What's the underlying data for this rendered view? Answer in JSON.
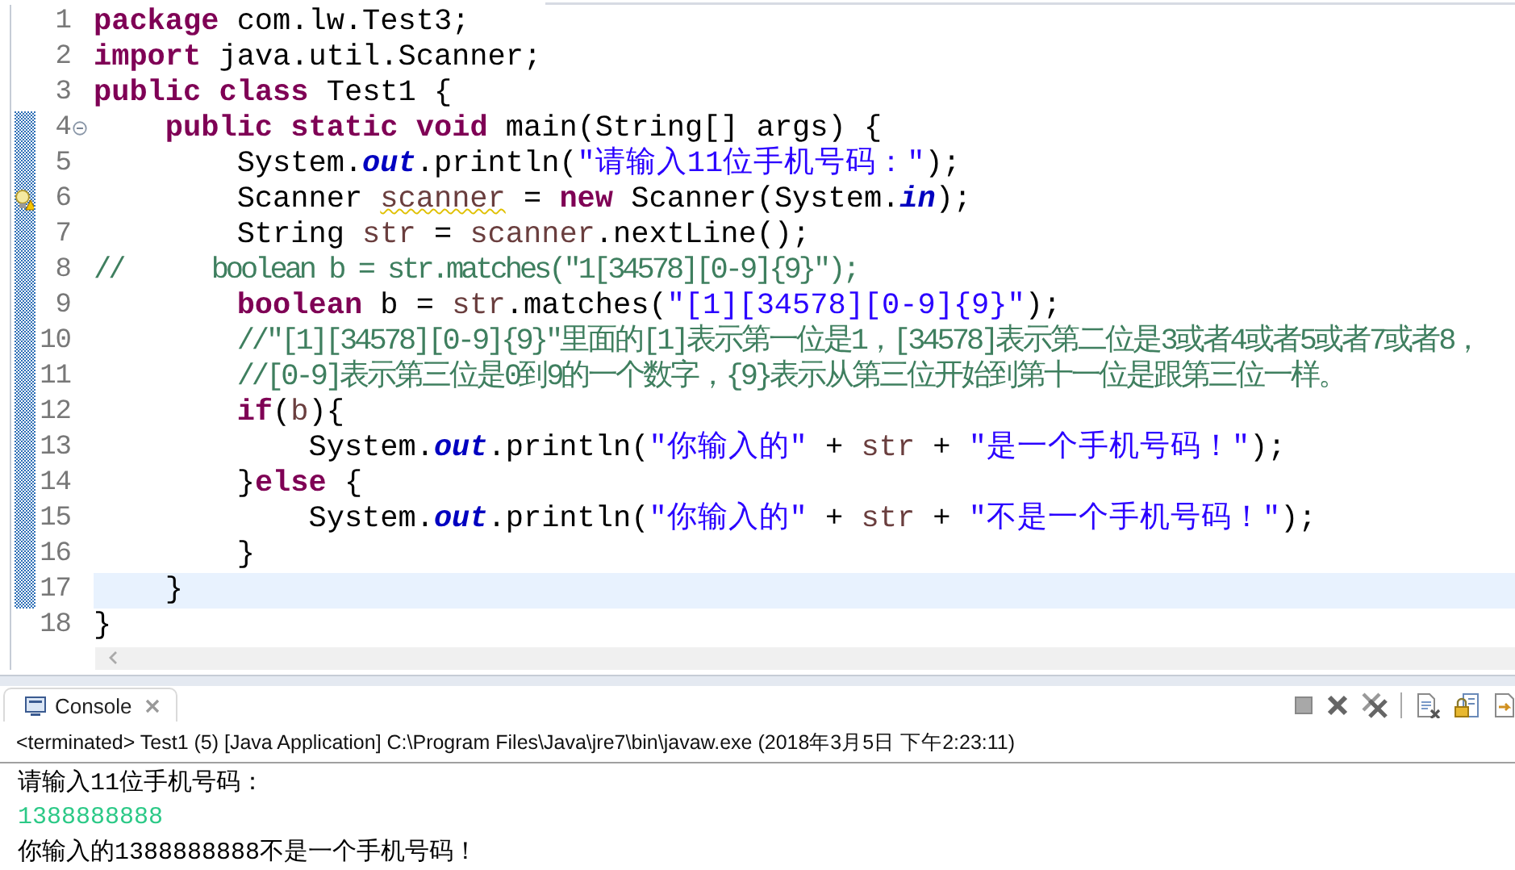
{
  "editor": {
    "lines": [
      {
        "number": "1",
        "changed": false,
        "current": false,
        "collapsible": false,
        "has_warning": false,
        "tokens": [
          {
            "kind": "keyword",
            "text": "package"
          },
          {
            "kind": "plain",
            "text": " com.lw.Test3;"
          }
        ]
      },
      {
        "number": "2",
        "changed": false,
        "current": false,
        "collapsible": false,
        "has_warning": false,
        "tokens": [
          {
            "kind": "keyword",
            "text": "import"
          },
          {
            "kind": "plain",
            "text": " java.util.Scanner;"
          }
        ]
      },
      {
        "number": "3",
        "changed": false,
        "current": false,
        "collapsible": false,
        "has_warning": false,
        "tokens": [
          {
            "kind": "keyword",
            "text": "public"
          },
          {
            "kind": "keyword",
            "text": " class"
          },
          {
            "kind": "plain",
            "text": " Test1 {"
          }
        ]
      },
      {
        "number": "4",
        "changed": true,
        "current": false,
        "collapsible": true,
        "has_warning": false,
        "tokens": [
          {
            "kind": "keyword",
            "text": "    public"
          },
          {
            "kind": "keyword",
            "text": " static"
          },
          {
            "kind": "keyword",
            "text": " void"
          },
          {
            "kind": "plain",
            "text": " main(String[] args) {"
          }
        ]
      },
      {
        "number": "5",
        "changed": true,
        "current": false,
        "collapsible": false,
        "has_warning": false,
        "tokens": [
          {
            "kind": "plain",
            "text": "        System."
          },
          {
            "kind": "field",
            "text": "out"
          },
          {
            "kind": "plain",
            "text": ".println("
          },
          {
            "kind": "string",
            "text": "\"请输入11位手机号码：\""
          },
          {
            "kind": "plain",
            "text": ");"
          }
        ]
      },
      {
        "number": "6",
        "changed": true,
        "current": false,
        "collapsible": false,
        "has_warning": true,
        "tokens": [
          {
            "kind": "plain",
            "text": "        Scanner "
          },
          {
            "kind": "local_warning",
            "text": "scanner"
          },
          {
            "kind": "plain",
            "text": " = "
          },
          {
            "kind": "keyword",
            "text": "new"
          },
          {
            "kind": "plain",
            "text": " Scanner(System."
          },
          {
            "kind": "field",
            "text": "in"
          },
          {
            "kind": "plain",
            "text": ");"
          }
        ]
      },
      {
        "number": "7",
        "changed": true,
        "current": false,
        "collapsible": false,
        "has_warning": false,
        "tokens": [
          {
            "kind": "plain",
            "text": "        String "
          },
          {
            "kind": "local",
            "text": "str"
          },
          {
            "kind": "plain",
            "text": " = "
          },
          {
            "kind": "local",
            "text": "scanner"
          },
          {
            "kind": "plain",
            "text": ".nextLine();"
          }
        ]
      },
      {
        "number": "8",
        "changed": true,
        "current": false,
        "collapsible": false,
        "has_warning": false,
        "tokens": [
          {
            "kind": "comment",
            "text": "//      boolean b = str.matches(\"1[34578][0-9]{9}\");"
          }
        ]
      },
      {
        "number": "9",
        "changed": true,
        "current": false,
        "collapsible": false,
        "has_warning": false,
        "tokens": [
          {
            "kind": "keyword",
            "text": "        boolean"
          },
          {
            "kind": "plain",
            "text": " b = "
          },
          {
            "kind": "local",
            "text": "str"
          },
          {
            "kind": "plain",
            "text": ".matches("
          },
          {
            "kind": "string",
            "text": "\"[1][34578][0-9]{9}\""
          },
          {
            "kind": "plain",
            "text": ");"
          }
        ]
      },
      {
        "number": "10",
        "changed": true,
        "current": false,
        "collapsible": false,
        "has_warning": false,
        "tokens": [
          {
            "kind": "comment",
            "text": "        //\"[1][34578][0-9]{9}\"里面的[1]表示第一位是1，[34578]表示第二位是3或者4或者5或者7或者8，"
          }
        ]
      },
      {
        "number": "11",
        "changed": true,
        "current": false,
        "collapsible": false,
        "has_warning": false,
        "tokens": [
          {
            "kind": "comment",
            "text": "        //[0-9]表示第三位是0到9的一个数字，{9}表示从第三位开始到第十一位是跟第三位一样。"
          }
        ]
      },
      {
        "number": "12",
        "changed": true,
        "current": false,
        "collapsible": false,
        "has_warning": false,
        "tokens": [
          {
            "kind": "keyword",
            "text": "        if"
          },
          {
            "kind": "plain",
            "text": "("
          },
          {
            "kind": "local",
            "text": "b"
          },
          {
            "kind": "plain",
            "text": "){"
          }
        ]
      },
      {
        "number": "13",
        "changed": true,
        "current": false,
        "collapsible": false,
        "has_warning": false,
        "tokens": [
          {
            "kind": "plain",
            "text": "            System."
          },
          {
            "kind": "field",
            "text": "out"
          },
          {
            "kind": "plain",
            "text": ".println("
          },
          {
            "kind": "string",
            "text": "\"你输入的\""
          },
          {
            "kind": "plain",
            "text": " + "
          },
          {
            "kind": "local",
            "text": "str"
          },
          {
            "kind": "plain",
            "text": " + "
          },
          {
            "kind": "string",
            "text": "\"是一个手机号码！\""
          },
          {
            "kind": "plain",
            "text": ");"
          }
        ]
      },
      {
        "number": "14",
        "changed": true,
        "current": false,
        "collapsible": false,
        "has_warning": false,
        "tokens": [
          {
            "kind": "plain",
            "text": "        }"
          },
          {
            "kind": "keyword",
            "text": "else"
          },
          {
            "kind": "plain",
            "text": " {"
          }
        ]
      },
      {
        "number": "15",
        "changed": true,
        "current": false,
        "collapsible": false,
        "has_warning": false,
        "tokens": [
          {
            "kind": "plain",
            "text": "            System."
          },
          {
            "kind": "field",
            "text": "out"
          },
          {
            "kind": "plain",
            "text": ".println("
          },
          {
            "kind": "string",
            "text": "\"你输入的\""
          },
          {
            "kind": "plain",
            "text": " + "
          },
          {
            "kind": "local",
            "text": "str"
          },
          {
            "kind": "plain",
            "text": " + "
          },
          {
            "kind": "string",
            "text": "\"不是一个手机号码！\""
          },
          {
            "kind": "plain",
            "text": ");"
          }
        ]
      },
      {
        "number": "16",
        "changed": true,
        "current": false,
        "collapsible": false,
        "has_warning": false,
        "tokens": [
          {
            "kind": "plain",
            "text": "        }"
          }
        ]
      },
      {
        "number": "17",
        "changed": true,
        "current": true,
        "collapsible": false,
        "has_warning": false,
        "tokens": [
          {
            "kind": "plain",
            "text": "    }"
          }
        ]
      },
      {
        "number": "18",
        "changed": false,
        "current": false,
        "collapsible": false,
        "has_warning": false,
        "tokens": [
          {
            "kind": "plain",
            "text": "}"
          }
        ]
      }
    ]
  },
  "console": {
    "tab": {
      "label": "Console",
      "selected": true
    },
    "status": "<terminated> Test1 (5) [Java Application] C:\\Program Files\\Java\\jre7\\bin\\javaw.exe (2018年3月5日 下午2:23:11)",
    "output": [
      {
        "kind": "output",
        "text": "请输入11位手机号码："
      },
      {
        "kind": "input",
        "text": "1388888888"
      },
      {
        "kind": "output",
        "text": "你输入的1388888888不是一个手机号码！"
      }
    ]
  }
}
